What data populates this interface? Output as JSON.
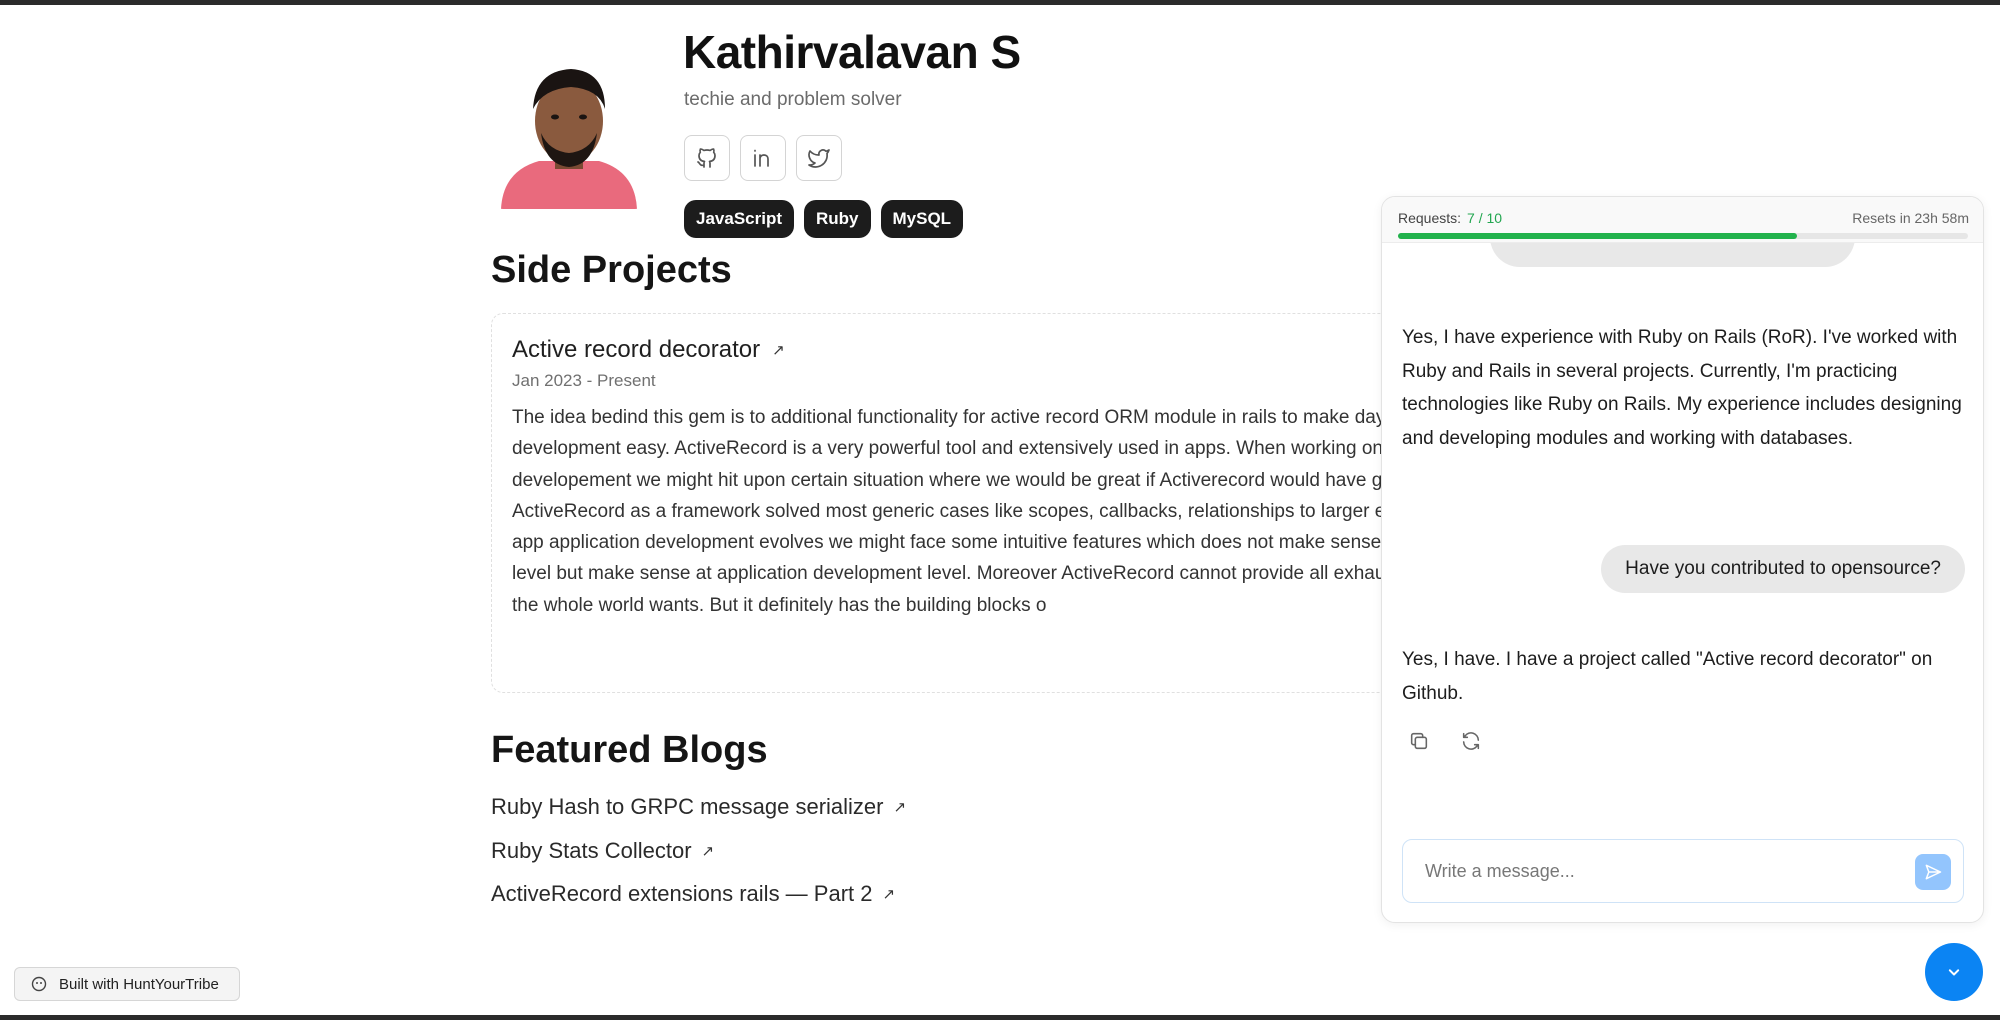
{
  "profile": {
    "name": "Kathirvalavan S",
    "tagline": "techie and problem solver",
    "socials": [
      "github-icon",
      "linkedin-icon",
      "twitter-icon"
    ],
    "tags": [
      "JavaScript",
      "Ruby",
      "MySQL"
    ]
  },
  "side_projects": {
    "heading": "Side Projects",
    "project": {
      "title": "Active record decorator",
      "date": "Jan 2023 - Present",
      "description": "The idea bedind this gem is to additional functionality for active record ORM module in rails to make day application development easy. ActiveRecord is a very powerful tool and extensively used in apps. When working on application developement we might hit upon certain situation where we would be great if Activerecord would have given us this\". ActiveRecord as a framework solved most generic cases like scopes, callbacks, relationships to larger extent. But as app application development evolves we might face some intuitive features which does not make sense at framework level but make sense at application development level. Moreover ActiveRecord cannot provide all exhaustive features the whole world wants. But it definitely has the building blocks o"
    }
  },
  "featured_blogs": {
    "heading": "Featured Blogs",
    "items": [
      "Ruby Hash to GRPC message serializer",
      "Ruby Stats Collector",
      "ActiveRecord extensions rails — Part 2"
    ]
  },
  "footer": {
    "built_with": "Built with HuntYourTribe"
  },
  "chat": {
    "requests_label": "Requests:",
    "requests_count": "7 / 10",
    "requests_used": 7,
    "requests_total": 10,
    "reset_text": "Resets in 23h 58m",
    "bot_message_1": "Yes, I have experience with Ruby on Rails (RoR). I've worked with Ruby and Rails in several projects. Currently, I'm practicing technologies like Ruby on Rails. My experience includes designing and developing modules and working with databases.",
    "user_message": "Have you contributed to opensource?",
    "bot_message_2": "Yes, I have. I have a project called \"Active record decorator\" on Github.",
    "input_placeholder": "Write a message..."
  },
  "colors": {
    "tag_bg": "#1c1c1c",
    "progress": "#22b24c",
    "accent": "#0b84f3",
    "send_button": "#93c5fd",
    "bubble": "#e8e8e8"
  }
}
